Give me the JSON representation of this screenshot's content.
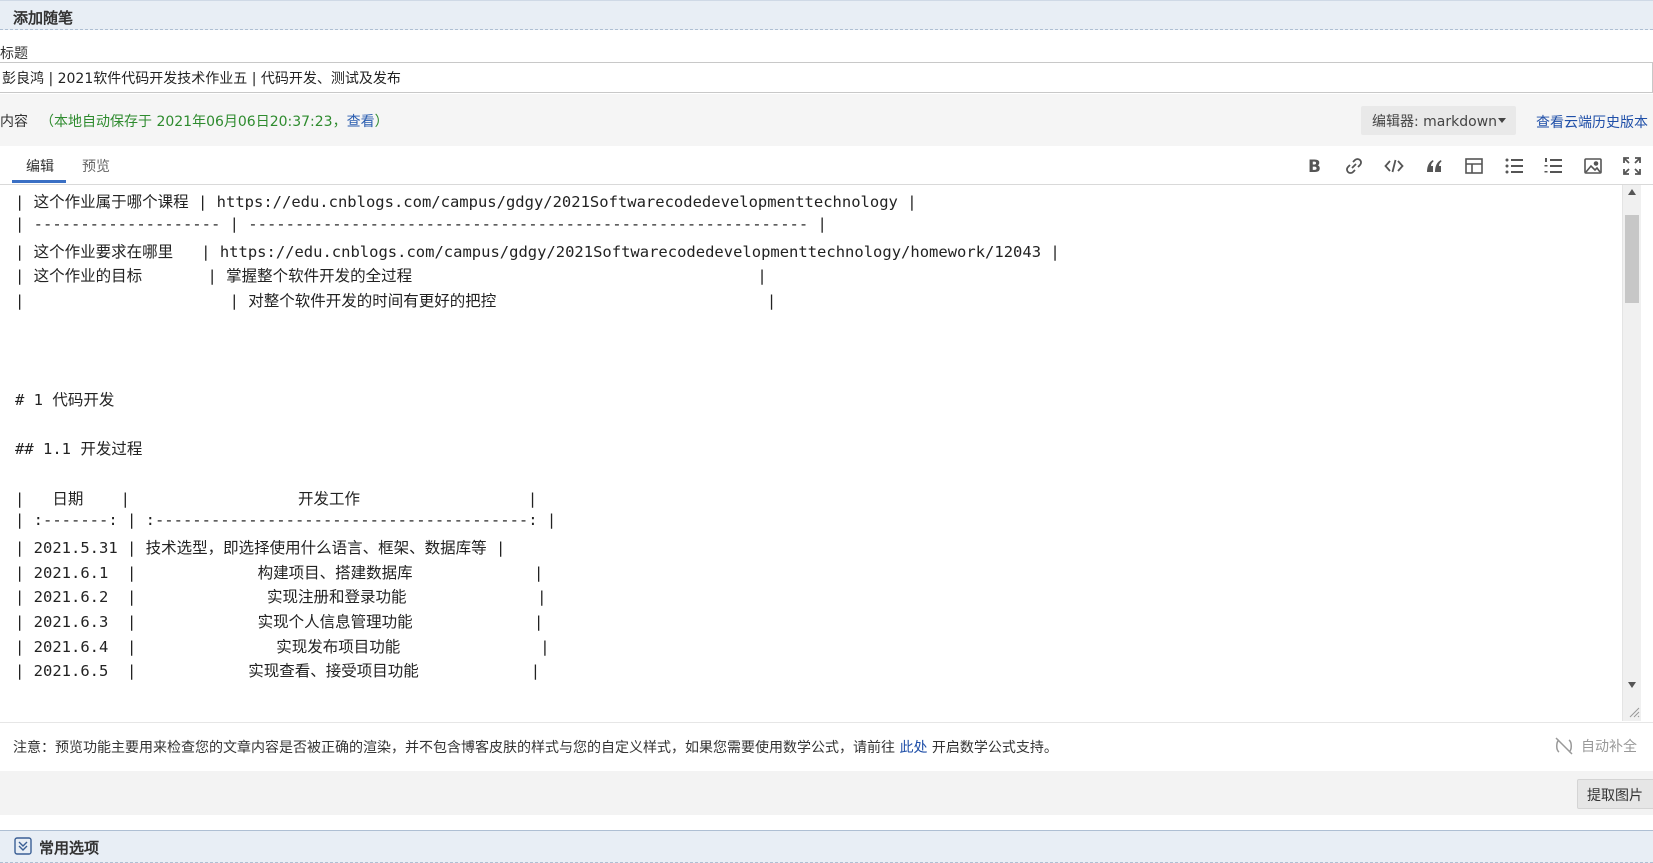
{
  "header": {
    "title": "添加随笔"
  },
  "title_field": {
    "label": "标题",
    "value": "彭良鸿 | 2021软件代码开发技术作业五 | 代码开发、测试及发布"
  },
  "content_bar": {
    "label": "内容",
    "autosave_prefix": "（本地自动保存于 2021年06月06日20:37:23，",
    "autosave_link": "查看",
    "autosave_suffix": "）",
    "editor_select": "编辑器: markdown",
    "history_link": "查看云端历史版本"
  },
  "tabs": [
    {
      "label": "编辑",
      "active": true
    },
    {
      "label": "预览",
      "active": false
    }
  ],
  "toolbar": {
    "icons": [
      "bold-icon",
      "link-icon",
      "code-icon",
      "quote-icon",
      "table-icon",
      "bullet-list-icon",
      "numbered-list-icon",
      "image-icon",
      "fullscreen-icon"
    ]
  },
  "editor": {
    "lines": [
      "| 这个作业属于哪个课程 | https://edu.cnblogs.com/campus/gdgy/2021Softwarecodedevelopmenttechnology |",
      "| -------------------- | ------------------------------------------------------------ |",
      "| 这个作业要求在哪里   | https://edu.cnblogs.com/campus/gdgy/2021Softwarecodedevelopmenttechnology/homework/12043 |",
      "| 这个作业的目标       | 掌握整个软件开发的全过程                                     |",
      "|                      | 对整个软件开发的时间有更好的把控                             |",
      "",
      "",
      "",
      "# 1 代码开发",
      "",
      "## 1.1 开发过程",
      "",
      "|   日期    |                  开发工作                  |",
      "| :-------: | :----------------------------------------: |",
      "| 2021.5.31 | 技术选型，即选择使用什么语言、框架、数据库等 |",
      "| 2021.6.1  |             构建项目、搭建数据库             |",
      "| 2021.6.2  |              实现注册和登录功能              |",
      "| 2021.6.3  |             实现个人信息管理功能             |",
      "| 2021.6.4  |               实现发布项目功能               |",
      "| 2021.6.5  |            实现查看、接受项目功能            |"
    ]
  },
  "notice": {
    "text_before": "注意：预览功能主要用来检查您的文章内容是否被正确的渲染，并不包含博客皮肤的样式与您的自定义样式，如果您需要使用数学公式，请前往 ",
    "link": "此处",
    "text_after": " 开启数学公式支持。",
    "autocomplete_label": "自动补全"
  },
  "image_bar": {
    "extract_button": "提取图片"
  },
  "options_bar": {
    "title": "常用选项"
  }
}
